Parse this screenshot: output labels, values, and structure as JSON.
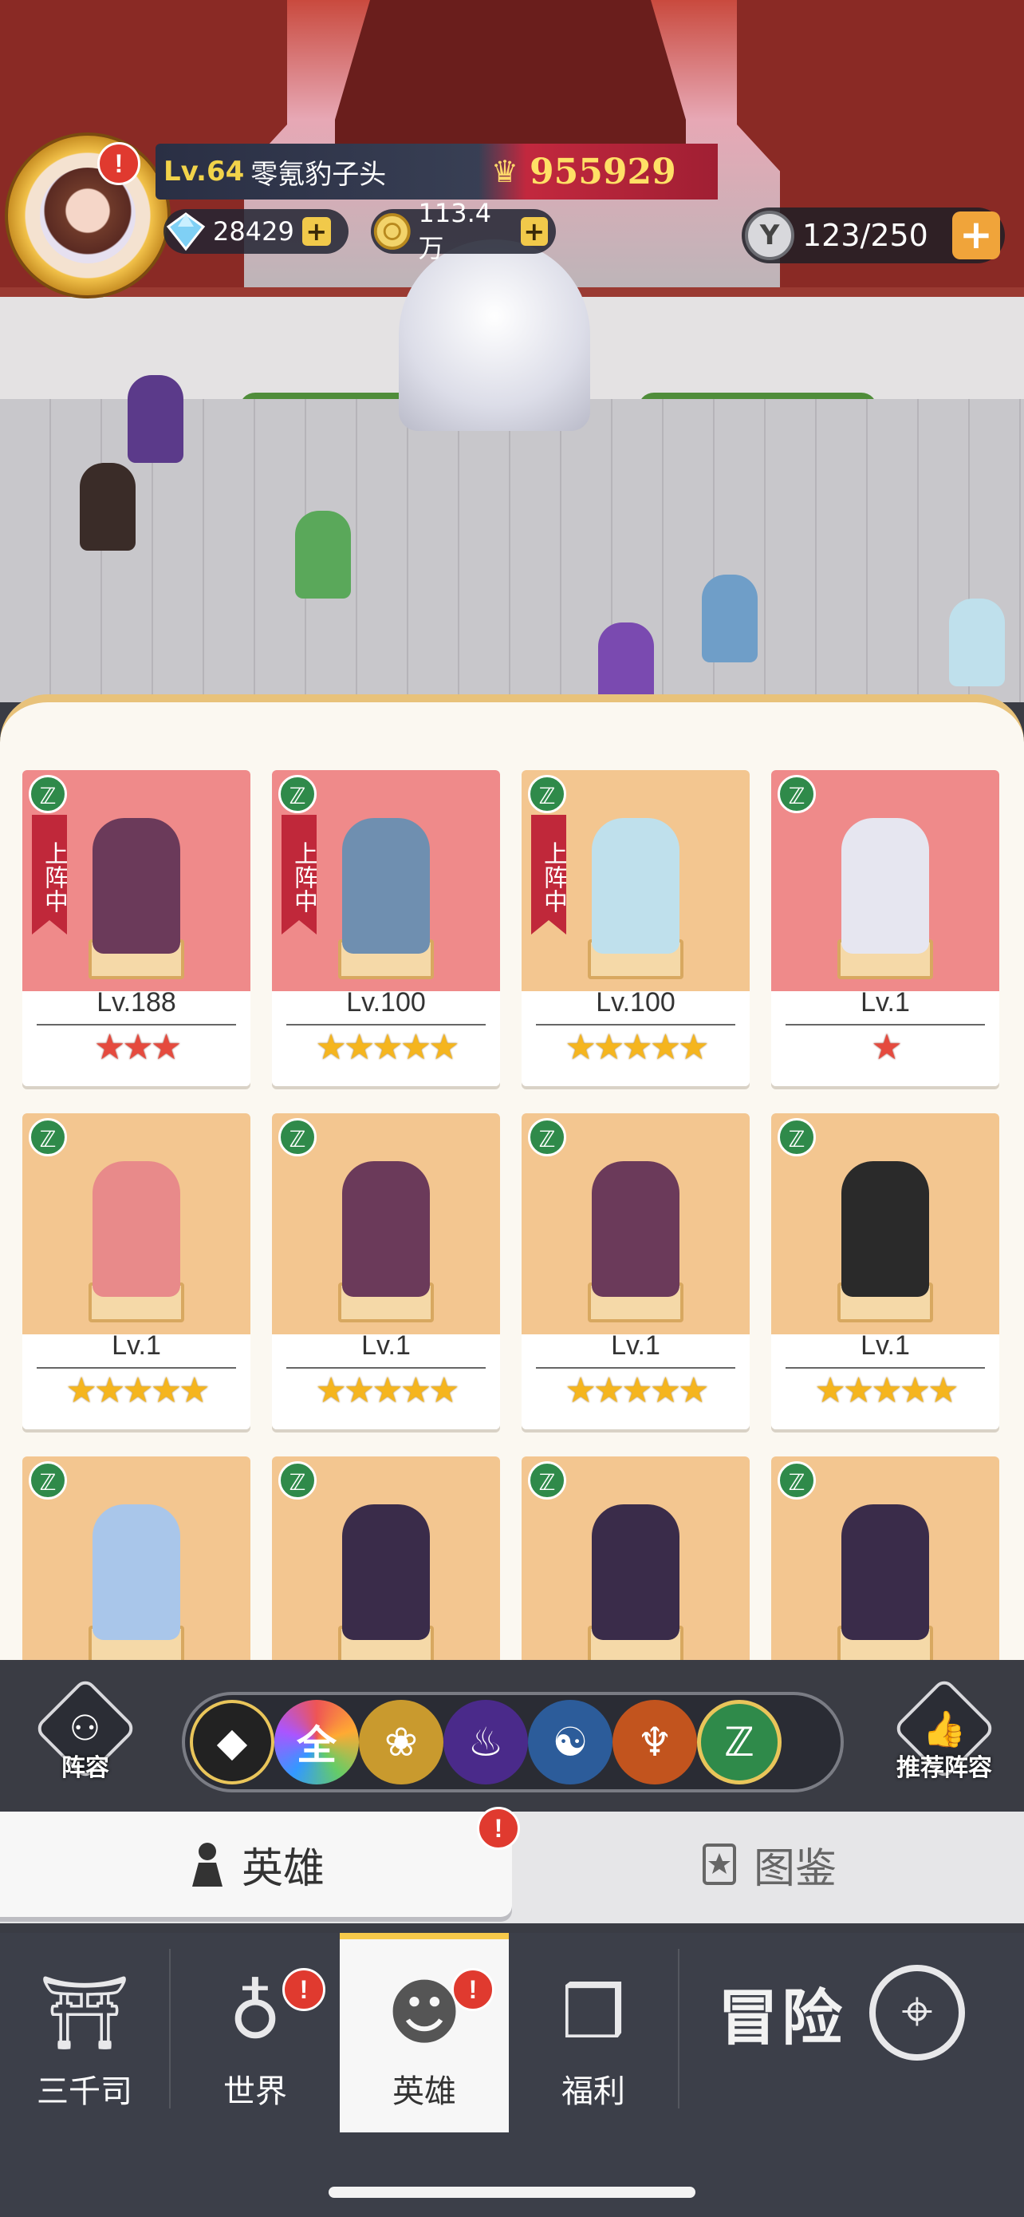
{
  "player": {
    "level_label": "Lv.64",
    "name": "零氪豹子头",
    "power": "955929",
    "diamonds": "28429",
    "gold": "113.4万",
    "hero_capacity": "123/250"
  },
  "colors": {
    "accent_gold": "#f2d34a",
    "power_red": "#c2283e",
    "alert_red": "#e03a2f",
    "faction_selected": "#2f8a4a"
  },
  "heroes": [
    {
      "level": "Lv.188",
      "stars": "★★★",
      "star_color": "red",
      "in_team": true,
      "bg": "pink"
    },
    {
      "level": "Lv.100",
      "stars": "★★★★★",
      "star_color": "gold",
      "in_team": true,
      "bg": "pink"
    },
    {
      "level": "Lv.100",
      "stars": "★★★★★",
      "star_color": "gold",
      "in_team": true,
      "bg": "orange"
    },
    {
      "level": "Lv.1",
      "stars": "★",
      "star_color": "red",
      "in_team": false,
      "bg": "pink"
    },
    {
      "level": "Lv.1",
      "stars": "★★★★★",
      "star_color": "gold",
      "in_team": false,
      "bg": "orange"
    },
    {
      "level": "Lv.1",
      "stars": "★★★★★",
      "star_color": "gold",
      "in_team": false,
      "bg": "orange"
    },
    {
      "level": "Lv.1",
      "stars": "★★★★★",
      "star_color": "gold",
      "in_team": false,
      "bg": "orange"
    },
    {
      "level": "Lv.1",
      "stars": "★★★★★",
      "star_color": "gold",
      "in_team": false,
      "bg": "orange"
    },
    {
      "level": "",
      "stars": "",
      "star_color": "gold",
      "in_team": false,
      "bg": "orange"
    },
    {
      "level": "",
      "stars": "",
      "star_color": "gold",
      "in_team": false,
      "bg": "orange"
    },
    {
      "level": "",
      "stars": "",
      "star_color": "gold",
      "in_team": false,
      "bg": "orange"
    },
    {
      "level": "",
      "stars": "",
      "star_color": "gold",
      "in_team": false,
      "bg": "orange"
    }
  ],
  "in_team_label": "上阵中",
  "filter": {
    "lineup_label": "阵容",
    "recommend_label": "推荐阵容",
    "all_label": "全",
    "factions": [
      "all-types-icon",
      "all",
      "lotus-icon",
      "purple-flame-icon",
      "water-swirl-icon",
      "fire-meditation-icon",
      "dna-icon"
    ],
    "selected": "dna-icon"
  },
  "tabs": {
    "heroes": "英雄",
    "codex": "图鉴"
  },
  "nav": {
    "items": [
      "三千司",
      "世界",
      "英雄",
      "福利"
    ],
    "adventure": "冒险",
    "active": "英雄"
  }
}
